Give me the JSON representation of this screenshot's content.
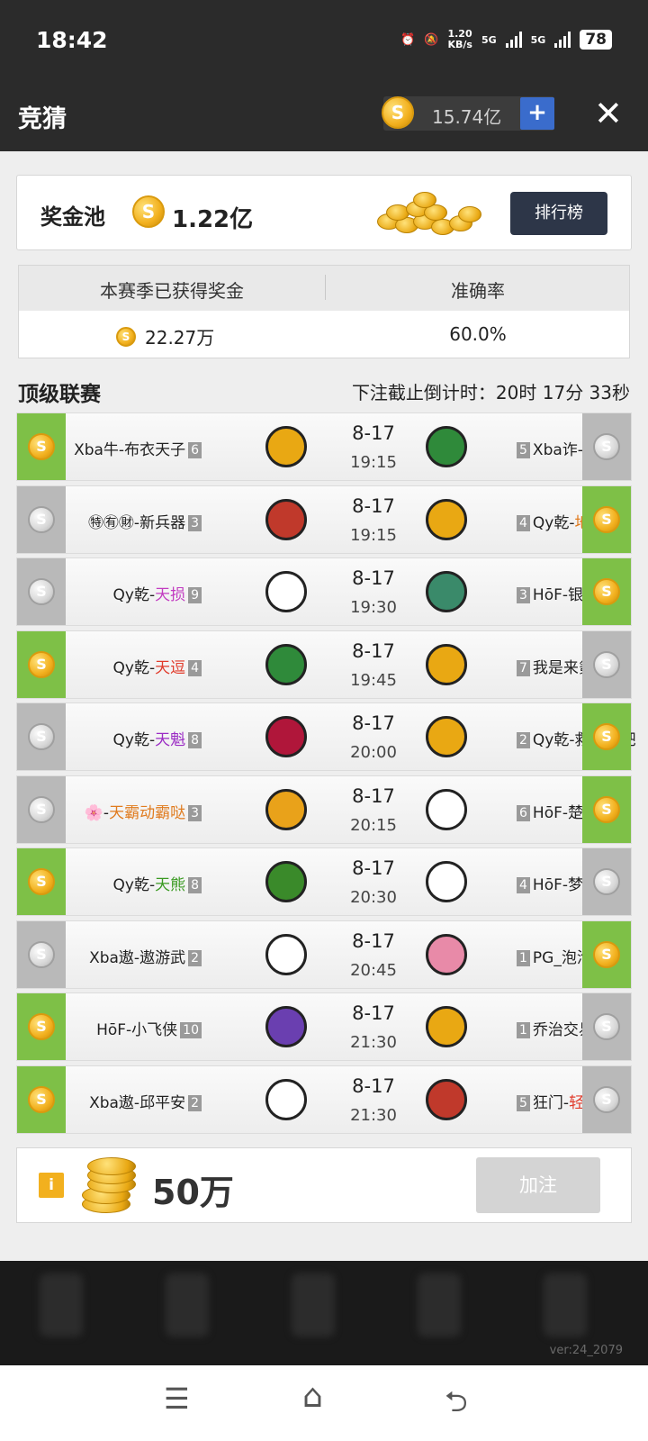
{
  "status": {
    "time": "18:42",
    "speed": "1.20\nKB/s",
    "net1": "5G",
    "net2": "5G",
    "battery": "78"
  },
  "header": {
    "title": "竞猜",
    "balance": "15.74亿",
    "plus": "+",
    "close": "✕"
  },
  "pool": {
    "label": "奖金池",
    "value": "1.22亿",
    "rank_button": "排行榜"
  },
  "stats": {
    "col1_header": "本赛季已获得奖金",
    "col2_header": "准确率",
    "earned": "22.27万",
    "accuracy": "60.0%"
  },
  "league": {
    "title": "顶级联赛",
    "countdown": "下注截止倒计时：20时 17分 33秒"
  },
  "matches": [
    {
      "home_prefix": "Xba牛-布衣天子",
      "home_hl": "",
      "home_num": "6",
      "away_prefix": "Xba诈-wdzs",
      "away_hl": "",
      "away_num": "5",
      "date": "8-17",
      "time": "19:15",
      "pick": "home"
    },
    {
      "home_prefix": "㊕㊒㊖-新兵器",
      "home_hl": "",
      "home_num": "3",
      "away_prefix": "Qy乾-",
      "away_hl": "地良",
      "away_num": "4",
      "date": "8-17",
      "time": "19:15",
      "pick": "away"
    },
    {
      "home_prefix": "Qy乾-",
      "home_hl": "天损",
      "home_num": "9",
      "away_prefix": "HōF-银狼踏雪",
      "away_hl": "",
      "away_num": "3",
      "date": "8-17",
      "time": "19:30",
      "pick": "away"
    },
    {
      "home_prefix": "Qy乾-",
      "home_hl": "天逗",
      "home_num": "4",
      "away_prefix": "我是来氪金的",
      "away_hl": "",
      "away_num": "7",
      "date": "8-17",
      "time": "19:45",
      "pick": "home"
    },
    {
      "home_prefix": "Qy乾-",
      "home_hl": "天魁",
      "home_num": "8",
      "away_prefix": "Qy乾-救救我吧",
      "away_hl": "",
      "away_num": "2",
      "date": "8-17",
      "time": "20:00",
      "pick": "away"
    },
    {
      "home_prefix": "🌸-",
      "home_hl": "天霸动霸哒",
      "home_num": "3",
      "away_prefix": "HōF-楚江王",
      "away_hl": "",
      "away_num": "6",
      "date": "8-17",
      "time": "20:15",
      "pick": "away"
    },
    {
      "home_prefix": "Qy乾-",
      "home_hl": "天熊",
      "home_num": "8",
      "away_prefix": "HōF-梦泽渡舟",
      "away_hl": "",
      "away_num": "4",
      "date": "8-17",
      "time": "20:30",
      "pick": "home"
    },
    {
      "home_prefix": "Xba遨-遨游武",
      "home_hl": "",
      "home_num": "2",
      "away_prefix": "PG_泡泡龙",
      "away_hl": "",
      "away_num": "1",
      "date": "8-17",
      "time": "20:45",
      "pick": "away"
    },
    {
      "home_prefix": "HōF-小飞侠",
      "home_hl": "",
      "home_num": "10",
      "away_prefix": "乔治交易之神",
      "away_hl": "",
      "away_num": "1",
      "date": "8-17",
      "time": "21:30",
      "pick": "home"
    },
    {
      "home_prefix": "Xba遨-邱平安",
      "home_hl": "",
      "home_num": "2",
      "away_prefix": "狂门-",
      "away_hl": "轻狂",
      "away_num": "5",
      "date": "8-17",
      "time": "21:30",
      "pick": "home"
    }
  ],
  "bet": {
    "info": "i",
    "amount": "50万",
    "add_button": "加注"
  },
  "footer": {
    "version": "ver:24_2079"
  },
  "sysnav": {
    "menu": "☰",
    "home": "⌂",
    "back": "⮌"
  },
  "colors": {
    "win": "#7ec047",
    "lose": "#b9b9b9",
    "header": "#2b2b2b",
    "accent": "#3a6ccc"
  },
  "icons": {
    "coin": "coin-icon",
    "close": "close-icon",
    "plus": "plus-icon"
  }
}
